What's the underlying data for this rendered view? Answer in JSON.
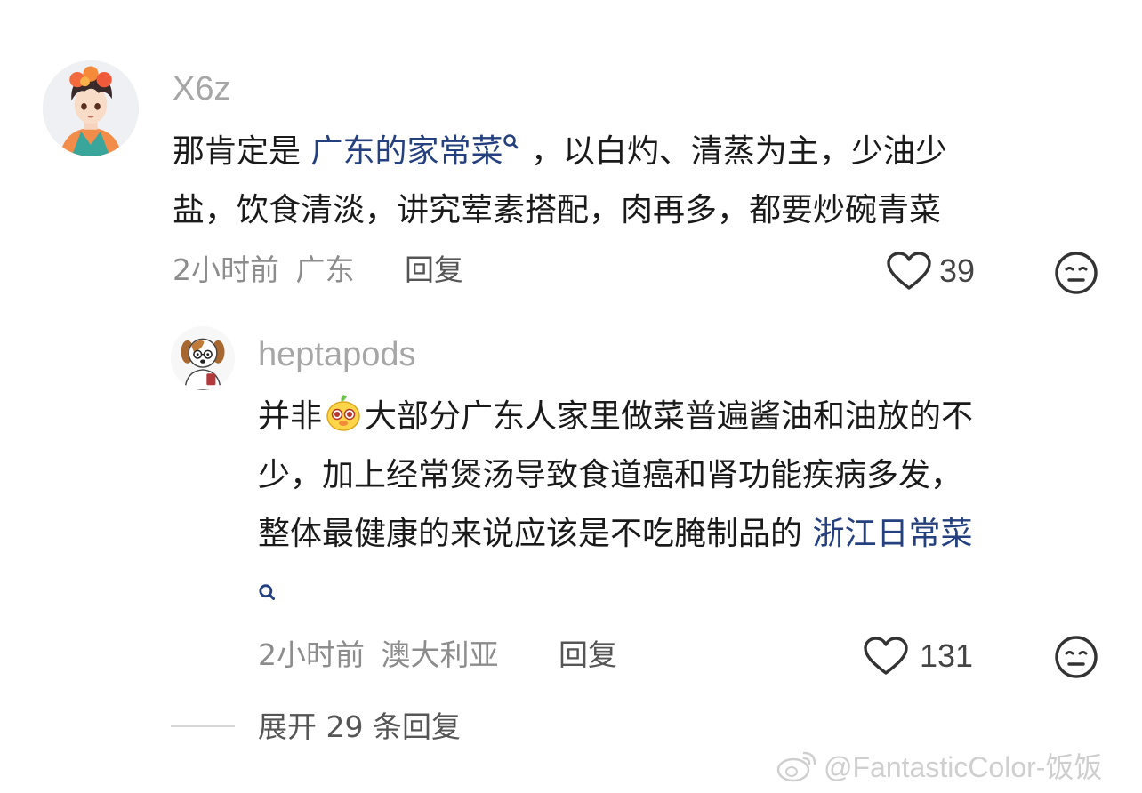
{
  "colors": {
    "link": "#25407e",
    "text": "#1a1a1a",
    "meta": "#8c8c8c",
    "username": "#a6a6a6"
  },
  "comment": {
    "username": "X6z",
    "text_before_link": "那肯定是 ",
    "link_text": "广东的家常菜",
    "text_line1_after": " ，以白灼、清蒸为主，少油少",
    "text_line2": "盐，饮食清淡，讲究荤素搭配，肉再多，都要炒碗青菜",
    "time": "2小时前",
    "location": "广东",
    "reply_label": "回复",
    "like_count": "39",
    "avatar_icon": "avatar-anime-boy-icon"
  },
  "reply": {
    "username": "heptapods",
    "line1_a": "并非",
    "emoji_icon": "bird-emoji-icon",
    "line1_b": "大部分广东人家里做菜普遍酱油和油放的不",
    "line2": "少，加上经常煲汤导致食道癌和肾功能疾病多发，",
    "line3_text": "整体最健康的来说应该是不吃腌制品的 ",
    "link_text": "浙江日常菜",
    "time": "2小时前",
    "location": "澳大利亚",
    "reply_label": "回复",
    "like_count": "131",
    "avatar_icon": "avatar-dog-icon"
  },
  "expand": {
    "label": "展开 29 条回复"
  },
  "watermark": {
    "text": "@FantasticColor-饭饭",
    "icon": "weibo-logo-icon"
  }
}
